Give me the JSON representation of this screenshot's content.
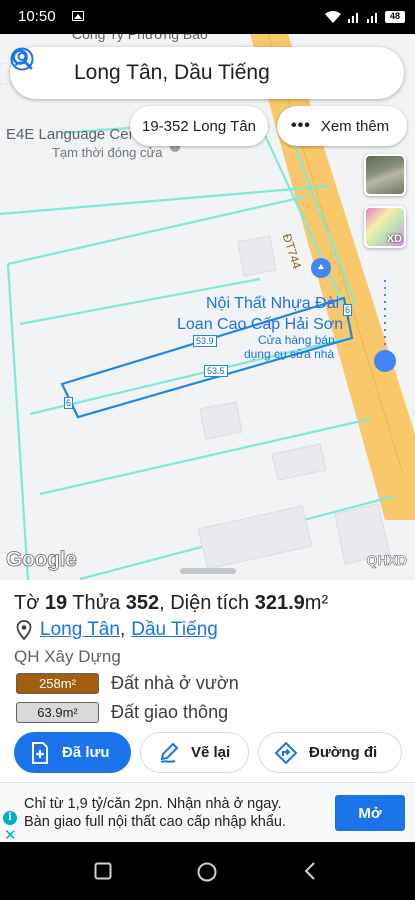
{
  "status_bar": {
    "time": "10:50",
    "battery": "48"
  },
  "search": {
    "query": "Long Tân, Dầu Tiếng"
  },
  "chips": {
    "lot": "19-352 Long Tân",
    "more": "Xem thêm"
  },
  "map": {
    "company_label": "Công Ty Phương Bảo",
    "school_name": "E4E Language Cen",
    "school_status": "Tạm thời đóng cửa",
    "road_label": "ĐT744",
    "store_name_line1": "Nội Thất Nhựa Đài",
    "store_name_line2": "Loan Cao Cấp Hải Sơn",
    "store_type_line1": "Cửa hàng bán",
    "store_type_line2": "dụng cụ sửa nhà",
    "edge_labels": [
      "53.9",
      "53.5",
      "6",
      "6"
    ],
    "layer_xd_label": "XD",
    "google_logo": "Google",
    "qhxd_logo": "QHXD"
  },
  "parcel": {
    "title_prefix": "Tờ ",
    "sheet_no": "19",
    "title_mid": " Thửa ",
    "lot_no": "352",
    "title_area": ", Diện tích ",
    "area": "321.9",
    "area_unit": "m²",
    "commune": "Long Tân",
    "district": "Dầu Tiếng",
    "plan_type": "QH Xây Dựng",
    "land_uses": [
      {
        "area": "258m²",
        "label": "Đất nhà ở vườn",
        "color": "#a35e0d"
      },
      {
        "area": "63.9m²",
        "label": "Đất giao thông",
        "color": "#d9d9d9"
      }
    ]
  },
  "actions": {
    "saved": "Đã lưu",
    "redraw": "Vẽ lại",
    "route": "Đường đi"
  },
  "ad": {
    "line1": "Chỉ từ 1,9 tỷ/căn 2pn. Nhận nhà ở ngay.",
    "line2": "Bàn giao full nội thất cao cấp nhập khẩu.",
    "button": "Mở"
  },
  "colors": {
    "accent": "#1a73e8",
    "parcel_line": "#80e8d8",
    "road": "#f8c86a",
    "selected_outline": "#1e88e5"
  }
}
